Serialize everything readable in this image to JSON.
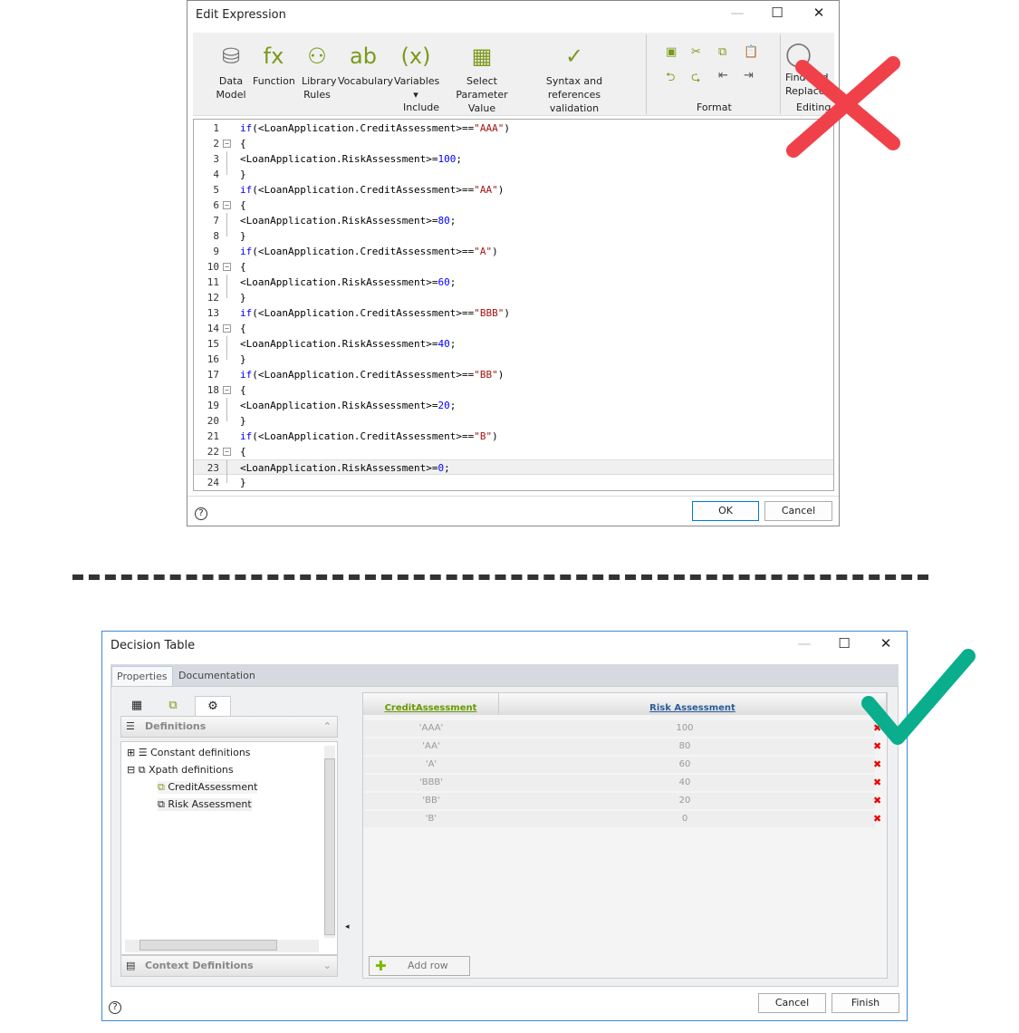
{
  "edit_expression": {
    "title": "Edit Expression",
    "ribbon": {
      "include": [
        {
          "label1": "Data",
          "label2": "Model",
          "icon": "data-model-icon"
        },
        {
          "label1": "Function",
          "label2": "",
          "icon": "function-icon"
        },
        {
          "label1": "Library",
          "label2": "Rules",
          "icon": "library-rules-icon"
        },
        {
          "label1": "Vocabulary",
          "label2": "",
          "icon": "vocabulary-icon"
        },
        {
          "label1": "Variables",
          "label2": "▾",
          "icon": "variables-icon"
        },
        {
          "label1": "Select Parameter",
          "label2": "Value",
          "icon": "select-parameter-icon"
        },
        {
          "label1": "Syntax and references",
          "label2": "validation",
          "icon": "validation-icon"
        }
      ],
      "group_include": "Include",
      "group_format": "Format",
      "group_editing": "Editing",
      "find_label1": "Find And",
      "find_label2": "Replace"
    },
    "code_lines": [
      [
        {
          "t": "if",
          "c": "k"
        },
        {
          "t": "(<LoanApplication.CreditAssessment>==",
          "c": "p"
        },
        {
          "t": "\"AAA\"",
          "c": "s"
        },
        {
          "t": ")",
          "c": "p"
        }
      ],
      [
        {
          "t": "{",
          "c": "p"
        }
      ],
      [
        {
          "t": "<LoanApplication.RiskAssessment>=",
          "c": "p"
        },
        {
          "t": "100",
          "c": "n"
        },
        {
          "t": ";",
          "c": "p"
        }
      ],
      [
        {
          "t": "}",
          "c": "p"
        }
      ],
      [
        {
          "t": "if",
          "c": "k"
        },
        {
          "t": "(<LoanApplication.CreditAssessment>==",
          "c": "p"
        },
        {
          "t": "\"AA\"",
          "c": "s"
        },
        {
          "t": ")",
          "c": "p"
        }
      ],
      [
        {
          "t": "{",
          "c": "p"
        }
      ],
      [
        {
          "t": "<LoanApplication.RiskAssessment>=",
          "c": "p"
        },
        {
          "t": "80",
          "c": "n"
        },
        {
          "t": ";",
          "c": "p"
        }
      ],
      [
        {
          "t": "}",
          "c": "p"
        }
      ],
      [
        {
          "t": "if",
          "c": "k"
        },
        {
          "t": "(<LoanApplication.CreditAssessment>==",
          "c": "p"
        },
        {
          "t": "\"A\"",
          "c": "s"
        },
        {
          "t": ")",
          "c": "p"
        }
      ],
      [
        {
          "t": "{",
          "c": "p"
        }
      ],
      [
        {
          "t": "<LoanApplication.RiskAssessment>=",
          "c": "p"
        },
        {
          "t": "60",
          "c": "n"
        },
        {
          "t": ";",
          "c": "p"
        }
      ],
      [
        {
          "t": "}",
          "c": "p"
        }
      ],
      [
        {
          "t": "if",
          "c": "k"
        },
        {
          "t": "(<LoanApplication.CreditAssessment>==",
          "c": "p"
        },
        {
          "t": "\"BBB\"",
          "c": "s"
        },
        {
          "t": ")",
          "c": "p"
        }
      ],
      [
        {
          "t": "{",
          "c": "p"
        }
      ],
      [
        {
          "t": "<LoanApplication.RiskAssessment>=",
          "c": "p"
        },
        {
          "t": "40",
          "c": "n"
        },
        {
          "t": ";",
          "c": "p"
        }
      ],
      [
        {
          "t": "}",
          "c": "p"
        }
      ],
      [
        {
          "t": "if",
          "c": "k"
        },
        {
          "t": "(<LoanApplication.CreditAssessment>==",
          "c": "p"
        },
        {
          "t": "\"BB\"",
          "c": "s"
        },
        {
          "t": ")",
          "c": "p"
        }
      ],
      [
        {
          "t": "{",
          "c": "p"
        }
      ],
      [
        {
          "t": "<LoanApplication.RiskAssessment>=",
          "c": "p"
        },
        {
          "t": "20",
          "c": "n"
        },
        {
          "t": ";",
          "c": "p"
        }
      ],
      [
        {
          "t": "}",
          "c": "p"
        }
      ],
      [
        {
          "t": "if",
          "c": "k"
        },
        {
          "t": "(<LoanApplication.CreditAssessment>==",
          "c": "p"
        },
        {
          "t": "\"B\"",
          "c": "s"
        },
        {
          "t": ")",
          "c": "p"
        }
      ],
      [
        {
          "t": "{",
          "c": "p"
        }
      ],
      [
        {
          "t": "<LoanApplication.RiskAssessment>=",
          "c": "p"
        },
        {
          "t": "0",
          "c": "n"
        },
        {
          "t": ";",
          "c": "p"
        }
      ],
      [
        {
          "t": "}",
          "c": "p"
        }
      ]
    ],
    "ok": "OK",
    "cancel": "Cancel",
    "help": "?"
  },
  "decision_table": {
    "title": "Decision Table",
    "tabs": [
      "Properties",
      "Documentation"
    ],
    "definitions": "Definitions",
    "tree": [
      "Constant definitions",
      "Xpath definitions",
      "CreditAssessment",
      "Risk Assessment"
    ],
    "context": "Context Definitions",
    "columns": [
      "CreditAssessment",
      "Risk Assessment"
    ],
    "rows": [
      [
        "'AAA'",
        "100"
      ],
      [
        "'AA'",
        "80"
      ],
      [
        "'A'",
        "60"
      ],
      [
        "'BBB'",
        "40"
      ],
      [
        "'BB'",
        "20"
      ],
      [
        "'B'",
        "0"
      ]
    ],
    "add_row": "Add row",
    "cancel": "Cancel",
    "finish": "Finish",
    "help": "?"
  },
  "colors": {
    "wrong": "#f0414b",
    "right": "#0aae8c",
    "credit_header": "#6a9a00",
    "risk_header": "#2a5c9a"
  }
}
